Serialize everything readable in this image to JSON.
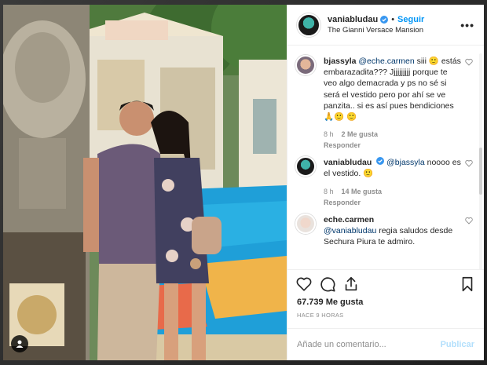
{
  "header": {
    "username": "vaniabludau",
    "follow_label": "Seguir",
    "separator": "•",
    "location": "The Gianni Versace Mansion",
    "more_label": "•••"
  },
  "comments": [
    {
      "user": "bjassyla",
      "mention": "@eche.carmen",
      "text": "siii 🙂 estás embarazadita??? Jjjjjjjjjj porque te veo algo demacrada y ps no sé si será el vestido pero por ahí se ve panzita.. si es así pues bendiciones🙏🙂 🙂",
      "time": "8 h",
      "likes": "2 Me gusta",
      "reply": "Responder"
    },
    {
      "user": "vaniabludau",
      "mention": "@bjassyla",
      "text": "noooo es el vestido. 🙂",
      "time": "8 h",
      "likes": "14 Me gusta",
      "reply": "Responder"
    },
    {
      "user": "eche.carmen",
      "mention": "@vaniabludau",
      "text": "regia saludos desde Sechura Piura te admiro.",
      "time": "",
      "likes": "",
      "reply": ""
    }
  ],
  "post": {
    "likes_text": "67.739 Me gusta",
    "date_text": "HACE 9 HORAS"
  },
  "composer": {
    "placeholder": "Añade un comentario...",
    "publish_label": "Publicar"
  },
  "colors": {
    "accent": "#0095f6",
    "publish_disabled": "#b2dffc",
    "verified": "#3897f0"
  }
}
